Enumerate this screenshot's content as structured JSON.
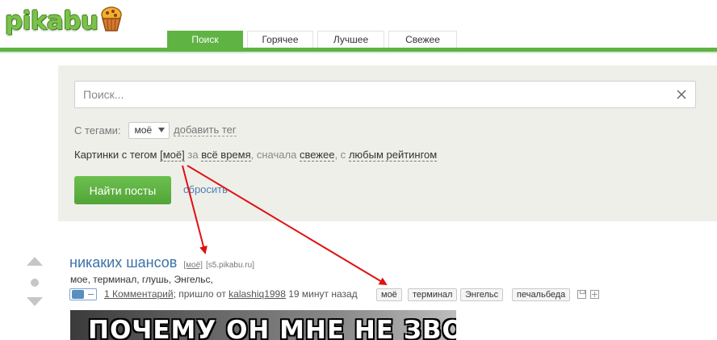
{
  "header": {
    "logo_text": "pikabu",
    "tabs": [
      {
        "label": "Поиск",
        "active": true
      },
      {
        "label": "Горячее",
        "active": false
      },
      {
        "label": "Лучшее",
        "active": false
      },
      {
        "label": "Свежее",
        "active": false
      }
    ]
  },
  "search": {
    "placeholder": "Поиск...",
    "tags_label": "С тегами:",
    "selected_tag": "моё",
    "add_tag_label": "добавить тег",
    "description": {
      "prefix": "Картинки с тегом",
      "tag": "[моё]",
      "for": "за",
      "period": "всё время",
      "order_prefix": ", сначала",
      "order": "свежее",
      "rating_prefix": ", с",
      "rating": "любым рейтингом"
    },
    "find_button": "Найти посты",
    "reset_link": "сбросить"
  },
  "post": {
    "title": "никаких шансов",
    "tag_badge": "[моё]",
    "source": "[s5.pikabu.ru]",
    "tags_text": "мое, терминал, глушь, Энгельс,",
    "comments_link": "1 Комментарий",
    "from_text": "; пришло от",
    "author": "kalashiq1998",
    "time": "19 минут назад",
    "tags": [
      "моё",
      "терминал",
      "Энгельс",
      "печальбеда"
    ],
    "image_caption": "ПОЧЕМУ ОН МНЕ НЕ ЗВОНИТ?(("
  },
  "colors": {
    "brand_green": "#5fb343",
    "link_blue": "#3c71a8",
    "arrow_red": "#e01010"
  }
}
